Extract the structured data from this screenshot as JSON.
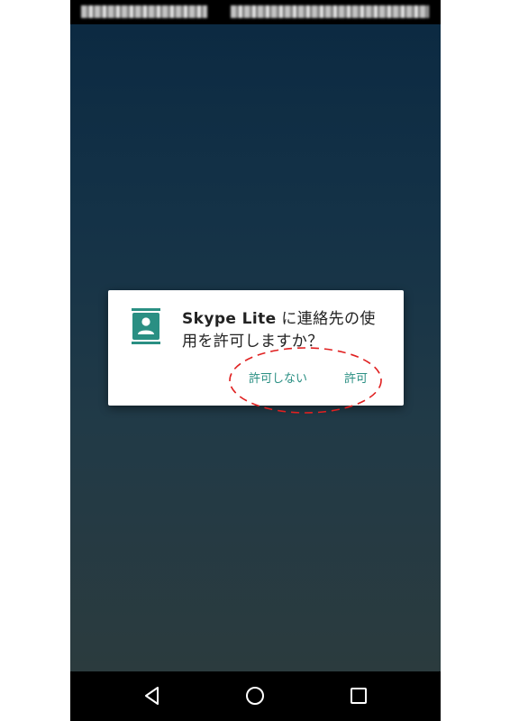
{
  "dialog": {
    "app_name": "Skype Lite",
    "message_rest": " に連絡先の使用を許可しますか？",
    "deny_label": "許可しない",
    "allow_label": "許可",
    "icon": "contacts-icon",
    "accent_color": "#2a8f83",
    "highlight_color": "#e02020"
  },
  "nav_bar": {
    "back_icon": "back-triangle-icon",
    "home_icon": "home-circle-icon",
    "recents_icon": "recents-square-icon"
  }
}
